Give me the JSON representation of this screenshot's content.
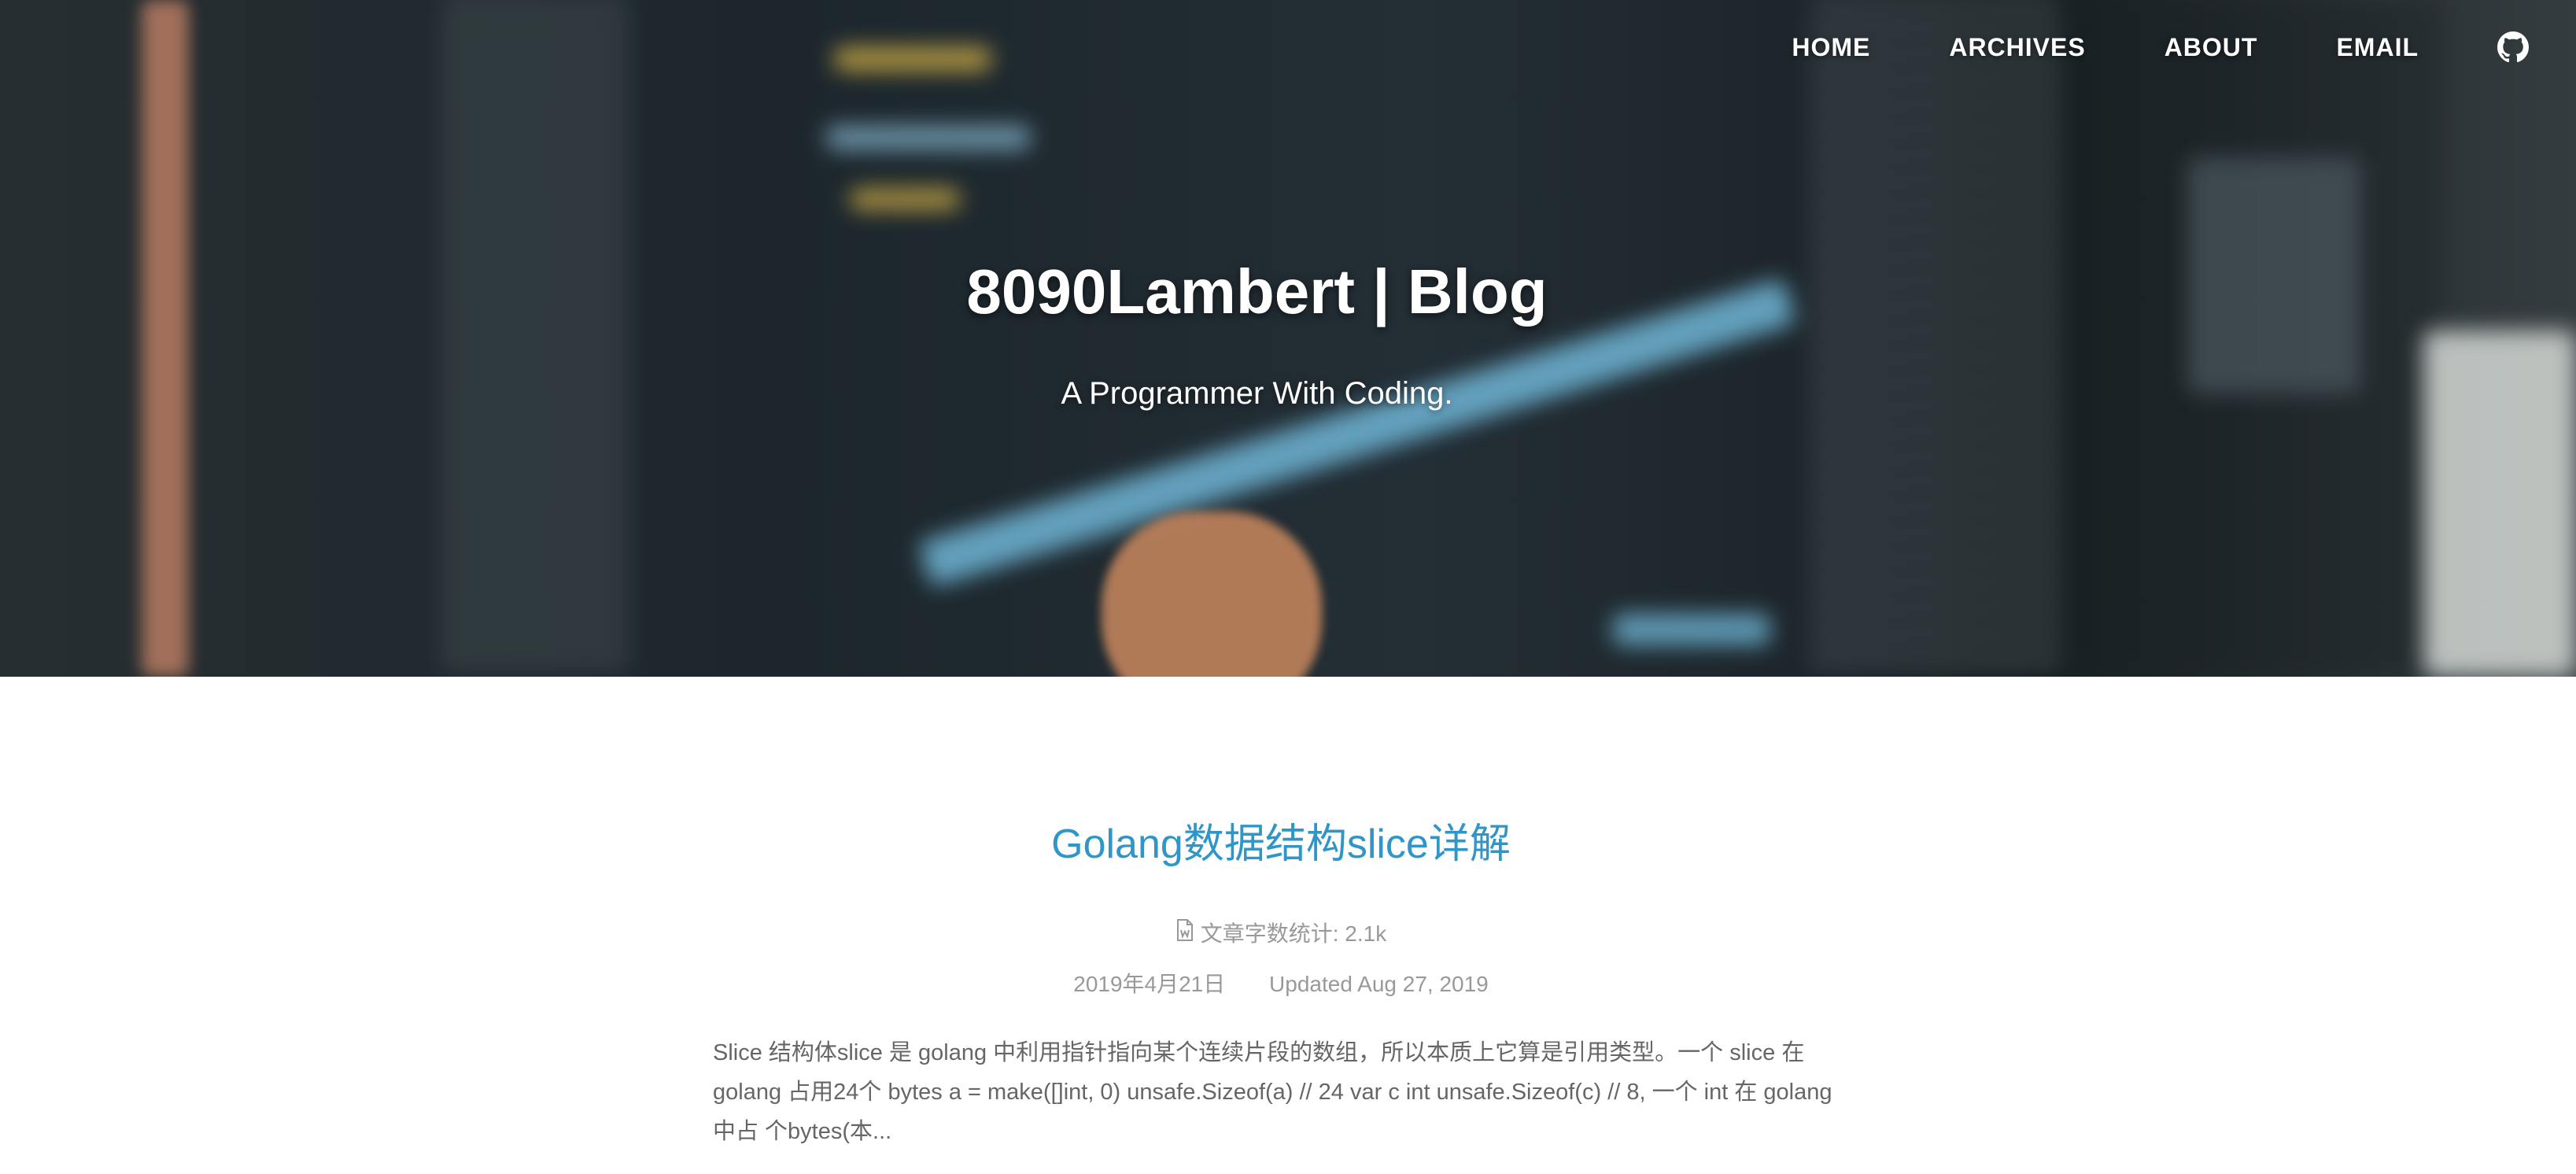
{
  "nav": {
    "items": [
      "HOME",
      "ARCHIVES",
      "ABOUT",
      "EMAIL"
    ],
    "github_icon": "github-icon"
  },
  "hero": {
    "title": "8090Lambert | Blog",
    "subtitle": "A Programmer With Coding."
  },
  "post": {
    "title": "Golang数据结构slice详解",
    "word_count_icon": "document-icon",
    "word_count": "文章字数统计: 2.1k",
    "date": "2019年4月21日",
    "updated": "Updated Aug 27, 2019",
    "excerpt": "Slice 结构体slice 是 golang 中利用指针指向某个连续片段的数组，所以本质上它算是引用类型。一个 slice 在 golang 占用24个 bytes a = make([]int, 0) unsafe.Sizeof(a) // 24 var c int unsafe.Sizeof(c) // 8, 一个 int 在 golang 中占 个bytes(本..."
  },
  "colors": {
    "accent": "#2e96c8",
    "meta": "#999999",
    "text": "#666666"
  }
}
